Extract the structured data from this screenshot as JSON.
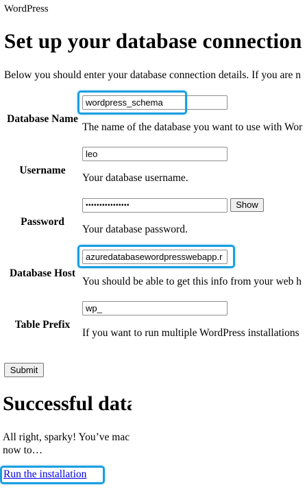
{
  "site_title": "WordPress",
  "heading": "Set up your database connection",
  "intro_text": "Below you should enter your database connection details. If you are n",
  "fields": {
    "dbname": {
      "label": "Database Name",
      "value": "wordpress_schema",
      "description": "The name of the database you want to use with Wor"
    },
    "username": {
      "label": "Username",
      "value": "leo",
      "description": "Your database username."
    },
    "password": {
      "label": "Password",
      "value": "••••••••••••••••",
      "description": "Your database password.",
      "show_label": "Show"
    },
    "dbhost": {
      "label": "Database Host",
      "value": "azuredatabasewordpresswebapp.r",
      "description": "You should be able to get this info from your web h"
    },
    "prefix": {
      "label": "Table Prefix",
      "value": "wp_",
      "description": "If you want to run multiple WordPress installations"
    }
  },
  "submit_label": "Submit",
  "success_heading": "Successful database connection",
  "success_message": "All right, sparky! You’ve made it through this part of the installation. WordPress can now communicate with your database. If you are ready, time now to…",
  "success_message_visible": "All right, sparky! You’ve mac\nnow to…",
  "install_link": "Run the installation",
  "highlight_color": "#1a9fe0"
}
